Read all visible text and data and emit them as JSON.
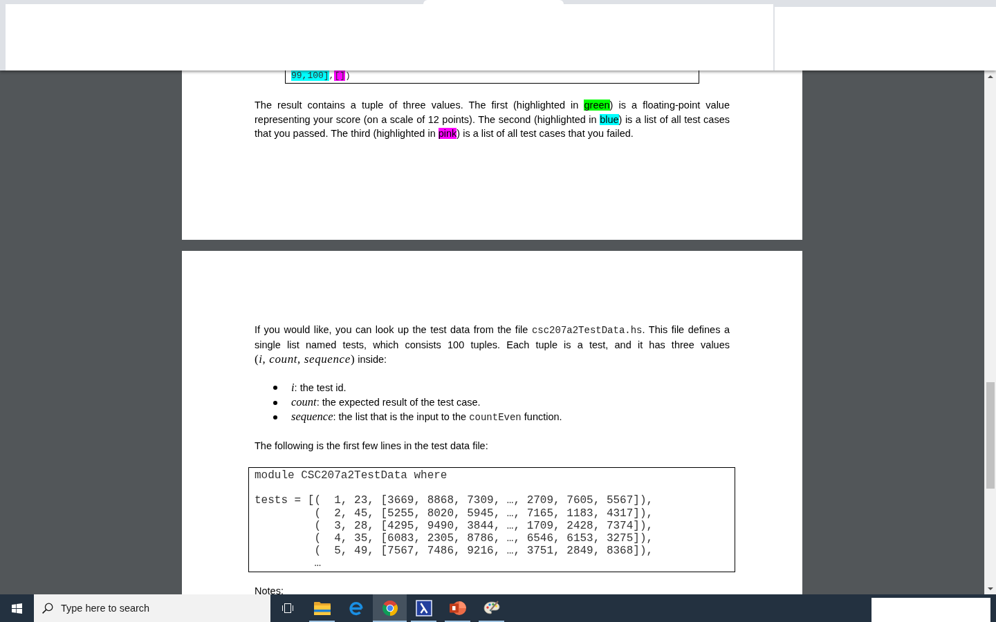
{
  "document": {
    "pages": [
      {
        "blocks": [
          {
            "kind": "output",
            "groups": [
              {
                "lines": [
                  [
                    {
                      "kind": "mark",
                      "text": "99,100]",
                      "color": "#00ffff"
                    },
                    {
                      "kind": "text",
                      "text": ","
                    },
                    {
                      "kind": "mark",
                      "text": "[]",
                      "color": "#ff00ff"
                    },
                    {
                      "kind": "text",
                      "text": ")"
                    }
                  ]
                ]
              }
            ]
          },
          {
            "kind": "paragraph",
            "segments": [
              {
                "kind": "text",
                "text": "The result contains a tuple of three values. The first (highlighted in "
              },
              {
                "kind": "mark",
                "text": "green",
                "color": "#00ff00"
              },
              {
                "kind": "text",
                "text": ") is a floating-point value representing your score (on a scale of 12 points). The second (highlighted in "
              },
              {
                "kind": "mark",
                "text": "blue",
                "color": "#00ffff"
              },
              {
                "kind": "text",
                "text": ") is a list of all test cases that you passed. The third (highlighted in "
              },
              {
                "kind": "mark",
                "text": "pink",
                "color": "#ff00ff"
              },
              {
                "kind": "text",
                "text": ") is a list of all test cases that you failed."
              }
            ]
          }
        ]
      },
      {
        "blocks": [
          {
            "kind": "paragraph",
            "segments": [
              {
                "kind": "text",
                "text": "If you would like, you can look up the test data from the file "
              },
              {
                "kind": "code",
                "text": "csc207a2TestData.hs"
              },
              {
                "kind": "text",
                "text": ". This file defines a single list named tests, which consists 100 tuples. Each tuple is a test, and it has three values "
              },
              {
                "kind": "math",
                "text": "(*i*, *count*, *sequence*)"
              },
              {
                "kind": "text",
                "text": " inside:"
              }
            ]
          },
          {
            "kind": "bullets",
            "items": [
              {
                "segments": [
                  {
                    "kind": "var",
                    "text": "i"
                  },
                  {
                    "kind": "text",
                    "text": ": the test id."
                  }
                ]
              },
              {
                "segments": [
                  {
                    "kind": "var",
                    "text": "count"
                  },
                  {
                    "kind": "text",
                    "text": ": the expected result of the test case."
                  }
                ]
              },
              {
                "segments": [
                  {
                    "kind": "var",
                    "text": "sequence"
                  },
                  {
                    "kind": "text",
                    "text": ": the list that is the input to the "
                  },
                  {
                    "kind": "code",
                    "text": "countEven"
                  },
                  {
                    "kind": "text",
                    "text": " function."
                  }
                ]
              }
            ]
          },
          {
            "kind": "paragraph",
            "segments": [
              {
                "kind": "text",
                "text": "The following is the first few lines in the test data file:"
              }
            ]
          },
          {
            "kind": "code",
            "groups": [
              {
                "lines": [
                  [
                    {
                      "kind": "text",
                      "text": "module CSC207a2TestData where"
                    }
                  ]
                ]
              },
              {
                "lines": [
                  [
                    {
                      "kind": "text",
                      "text": "tests = [(  1, 23, [3669, 8868, 7309, …, 2709, 7605, 5567]),"
                    }
                  ],
                  [
                    {
                      "kind": "text",
                      "text": "         (  2, 45, [5255, 8020, 5945, …, 7165, 1183, 4317]),"
                    }
                  ],
                  [
                    {
                      "kind": "text",
                      "text": "         (  3, 28, [4295, 9490, 3844, …, 1709, 2428, 7374]),"
                    }
                  ],
                  [
                    {
                      "kind": "text",
                      "text": "         (  4, 35, [6083, 2305, 8786, …, 6546, 6153, 3275]),"
                    }
                  ],
                  [
                    {
                      "kind": "text",
                      "text": "         (  5, 49, [7567, 7486, 9216, …, 3751, 2849, 8368]),"
                    }
                  ],
                  [
                    {
                      "kind": "text",
                      "text": "         …"
                    }
                  ]
                ]
              }
            ]
          },
          {
            "kind": "heading",
            "segments": [
              {
                "kind": "text",
                "text": "Notes:"
              }
            ]
          }
        ]
      }
    ]
  },
  "taskbar": {
    "search": {
      "placeholder": "Type here to search"
    },
    "apps": [
      {
        "kind": "folder",
        "running": true,
        "active": false
      },
      {
        "kind": "letter-e",
        "running": false,
        "active": false
      },
      {
        "kind": "segmented-circle",
        "running": true,
        "active": true
      },
      {
        "kind": "lambda",
        "running": true,
        "active": false
      },
      {
        "kind": "presentation",
        "running": true,
        "active": false
      },
      {
        "kind": "palette",
        "running": true,
        "active": false
      }
    ]
  }
}
